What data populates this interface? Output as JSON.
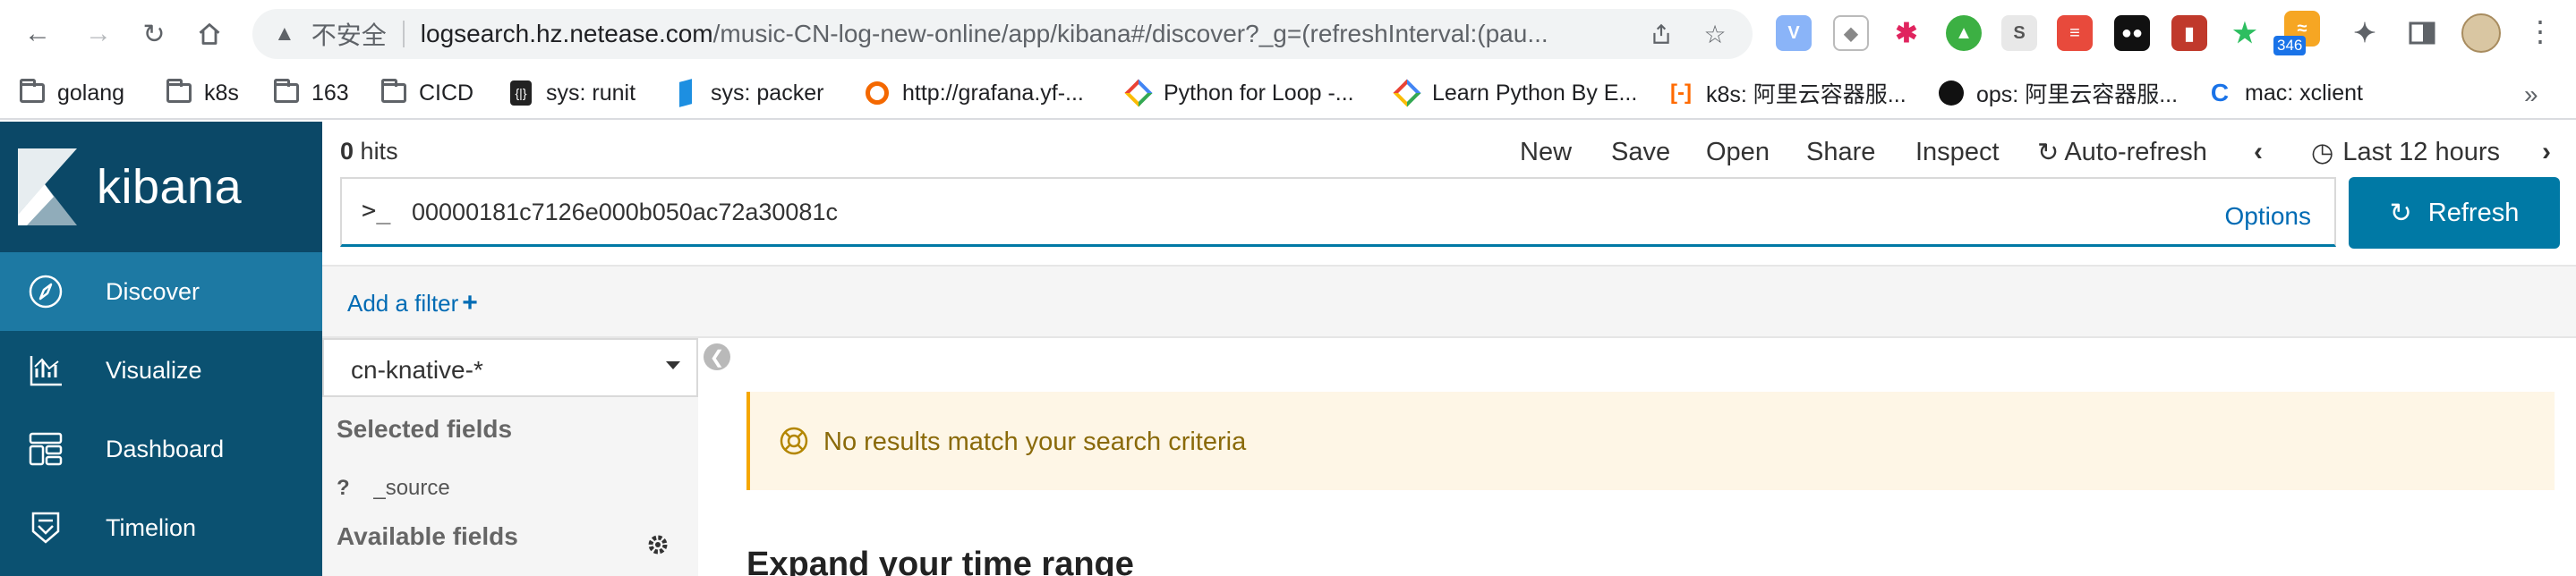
{
  "browser": {
    "url": {
      "insecure_label": "不安全",
      "host": "logsearch.hz.netease.com",
      "path": "/music-CN-log-new-online/app/kibana#/discover?_g=(refreshInterval:(pau..."
    },
    "extension_badge": "346",
    "bookmarks": [
      {
        "label": "golang",
        "icon": "folder-icon"
      },
      {
        "label": "k8s",
        "icon": "folder-icon"
      },
      {
        "label": "163",
        "icon": "folder-icon"
      },
      {
        "label": "CICD",
        "icon": "folder-icon"
      },
      {
        "label": "sys: runit",
        "icon": "runit-icon"
      },
      {
        "label": "sys: packer",
        "icon": "packer-icon"
      },
      {
        "label": "http://grafana.yf-...",
        "icon": "grafana-icon"
      },
      {
        "label": "Python for Loop -...",
        "icon": "google-icon"
      },
      {
        "label": "Learn Python By E...",
        "icon": "google-icon"
      },
      {
        "label": "k8s: 阿里云容器服...",
        "icon": "aliyun-icon"
      },
      {
        "label": "ops: 阿里云容器服...",
        "icon": "github-icon"
      },
      {
        "label": "mac: xclient",
        "icon": "xclient-icon"
      }
    ]
  },
  "kibana": {
    "brand": "kibana",
    "nav": [
      {
        "label": "Discover",
        "icon": "compass-icon",
        "active": true
      },
      {
        "label": "Visualize",
        "icon": "chart-icon",
        "active": false
      },
      {
        "label": "Dashboard",
        "icon": "dashboard-icon",
        "active": false
      },
      {
        "label": "Timelion",
        "icon": "timelion-icon",
        "active": false
      }
    ],
    "hits_count": "0",
    "hits_label": "hits",
    "topnav": {
      "new": "New",
      "save": "Save",
      "open": "Open",
      "share": "Share",
      "inspect": "Inspect",
      "auto_refresh": "Auto-refresh",
      "time_range": "Last 12 hours"
    },
    "query": {
      "prompt": ">_",
      "value": "00000181c7126e000b050ac72a30081c",
      "options": "Options"
    },
    "refresh_button": "Refresh",
    "add_filter": "Add a filter",
    "index_pattern": "cn-knative-*",
    "selected_fields_title": "Selected fields",
    "selected_fields": [
      {
        "type": "?",
        "name": "_source"
      }
    ],
    "available_fields_title": "Available fields",
    "no_results": "No results match your search criteria",
    "expand_title": "Expand your time range"
  },
  "colors": {
    "sidebar": "#0b5171",
    "sidebar_active": "#1d79a3",
    "primary": "#0079a5",
    "link": "#006bb4",
    "callout_bg": "#fef6e6",
    "callout_border": "#f5a700"
  }
}
